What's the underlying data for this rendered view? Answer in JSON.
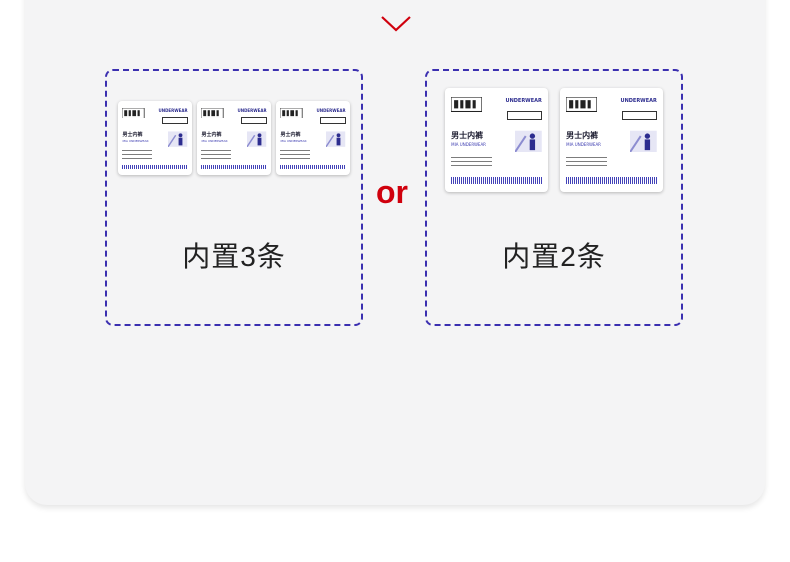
{
  "divider_text": "or",
  "colors": {
    "accent_red": "#d0000d",
    "border_purple": "#3b2fb0",
    "card_bg": "#f4f4f5"
  },
  "options": [
    {
      "label": "内置3条",
      "count": 3
    },
    {
      "label": "内置2条",
      "count": 2
    }
  ],
  "pack": {
    "brand_text": "UNDERWEAR",
    "product_name": "男士内裤",
    "sub_text": "MIA UNDERWEAR"
  },
  "icons": {
    "expand": "chevron-down-icon"
  }
}
